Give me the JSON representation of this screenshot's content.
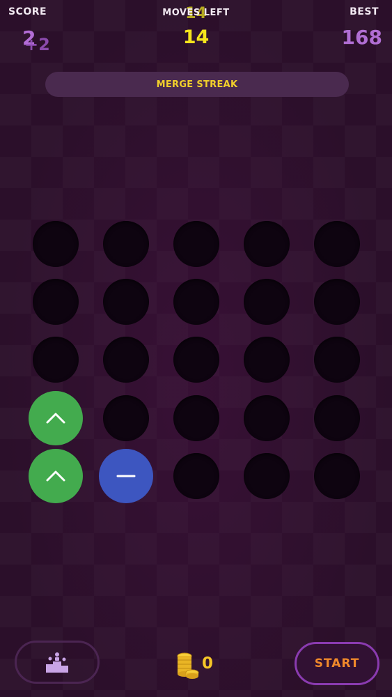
{
  "header": {
    "score_label": "SCORE",
    "score_value": "2",
    "score_popup": "+2",
    "moves_label": "MOVES LEFT",
    "moves_ghost": "14",
    "moves_value": "14",
    "best_label": "BEST",
    "best_value": "168"
  },
  "streak_bar": {
    "label": "MERGE STREAK"
  },
  "board": {
    "rows": 5,
    "cols": 5,
    "pieces": [
      {
        "row": 3,
        "col": 0,
        "color": "green",
        "symbol": "chevron-up"
      },
      {
        "row": 4,
        "col": 0,
        "color": "green",
        "symbol": "chevron-up"
      },
      {
        "row": 4,
        "col": 1,
        "color": "blue",
        "symbol": "minus"
      }
    ]
  },
  "footer": {
    "stats_icon": "podium-icon",
    "coin_icon": "coin-stack-icon",
    "coin_count": "0",
    "start_label": "START"
  },
  "colors": {
    "background": "#2b0f2a",
    "hole": "#0e0410",
    "green_piece": "#43ab4e",
    "blue_piece": "#3d56c0",
    "moves": "#f5e51c",
    "score": "#b36dd6",
    "streak_text": "#f2d02b",
    "start_text": "#f0892b",
    "coin": "#f5c628"
  }
}
